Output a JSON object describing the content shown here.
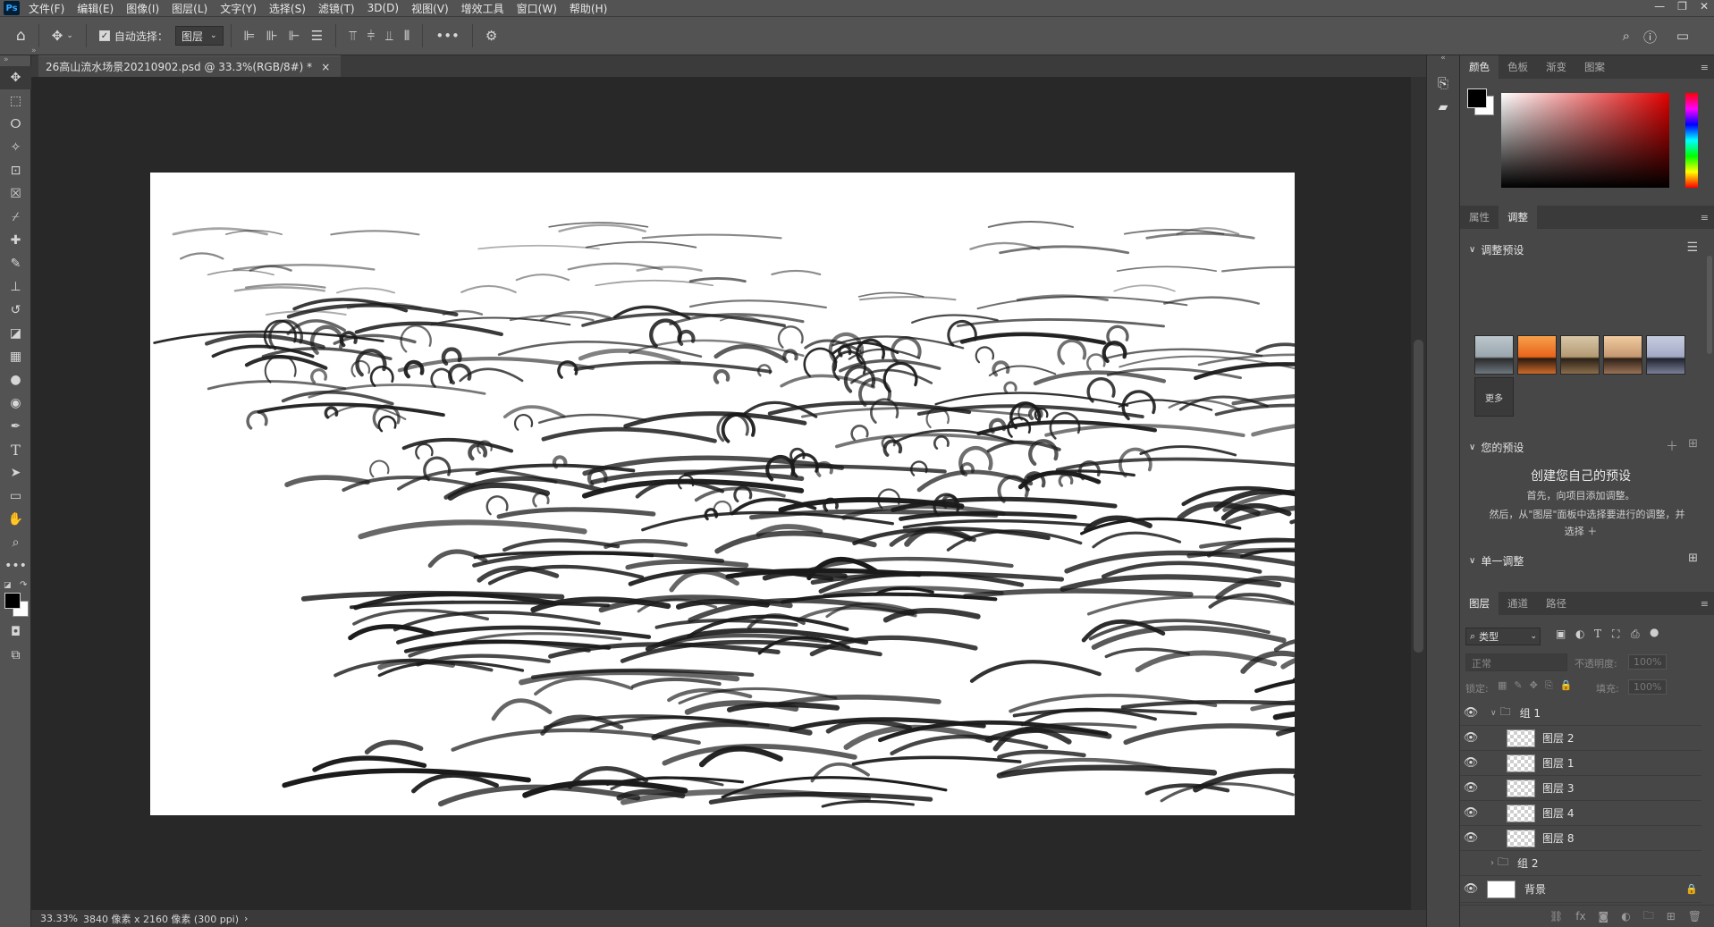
{
  "app": {
    "logo": "Ps"
  },
  "menus": [
    "文件(F)",
    "编辑(E)",
    "图像(I)",
    "图层(L)",
    "文字(Y)",
    "选择(S)",
    "滤镜(T)",
    "3D(D)",
    "视图(V)",
    "增效工具",
    "窗口(W)",
    "帮助(H)"
  ],
  "options": {
    "auto_select_label": "自动选择：",
    "auto_select_value": "图层",
    "more": "•••"
  },
  "document": {
    "tab_title": "26高山流水场景20210902.psd @ 33.3%(RGB/8#) *",
    "close": "×"
  },
  "status": {
    "zoom": "33.33%",
    "info": "3840 像素 x 2160 像素 (300 ppi)",
    "arrow": "›"
  },
  "color_panel": {
    "tabs": [
      "颜色",
      "色板",
      "渐变",
      "图案"
    ],
    "foreground": "#000000",
    "background": "#ffffff"
  },
  "adjust_panel": {
    "tabs": [
      "属性",
      "调整"
    ],
    "presets_title": "调整预设",
    "more_label": "更多",
    "your_presets_title": "您的预设",
    "create_title": "创建您自己的预设",
    "create_line1": "首先，向项目添加调整。",
    "create_line2": "然后，从\"图层\"面板中选择要进行的调整，并",
    "create_line3": "选择 ＋",
    "single_adjust_title": "单一调整"
  },
  "layers_panel": {
    "tabs": [
      "图层",
      "通道",
      "路径"
    ],
    "filter_label": "类型",
    "blend_mode": "正常",
    "opacity_label": "不透明度:",
    "opacity_value": "100%",
    "lock_label": "锁定:",
    "fill_label": "填充:",
    "fill_value": "100%",
    "layers": [
      {
        "name": "组 1",
        "kind": "group-open",
        "visible": true
      },
      {
        "name": "图层 2",
        "kind": "layer",
        "visible": true
      },
      {
        "name": "图层 1",
        "kind": "layer",
        "visible": true
      },
      {
        "name": "图层 3",
        "kind": "layer",
        "visible": true
      },
      {
        "name": "图层 4",
        "kind": "layer",
        "visible": true
      },
      {
        "name": "图层 8",
        "kind": "layer",
        "visible": true
      },
      {
        "name": "组 2",
        "kind": "group-closed",
        "visible": false
      },
      {
        "name": "背景",
        "kind": "background",
        "visible": true
      }
    ]
  }
}
